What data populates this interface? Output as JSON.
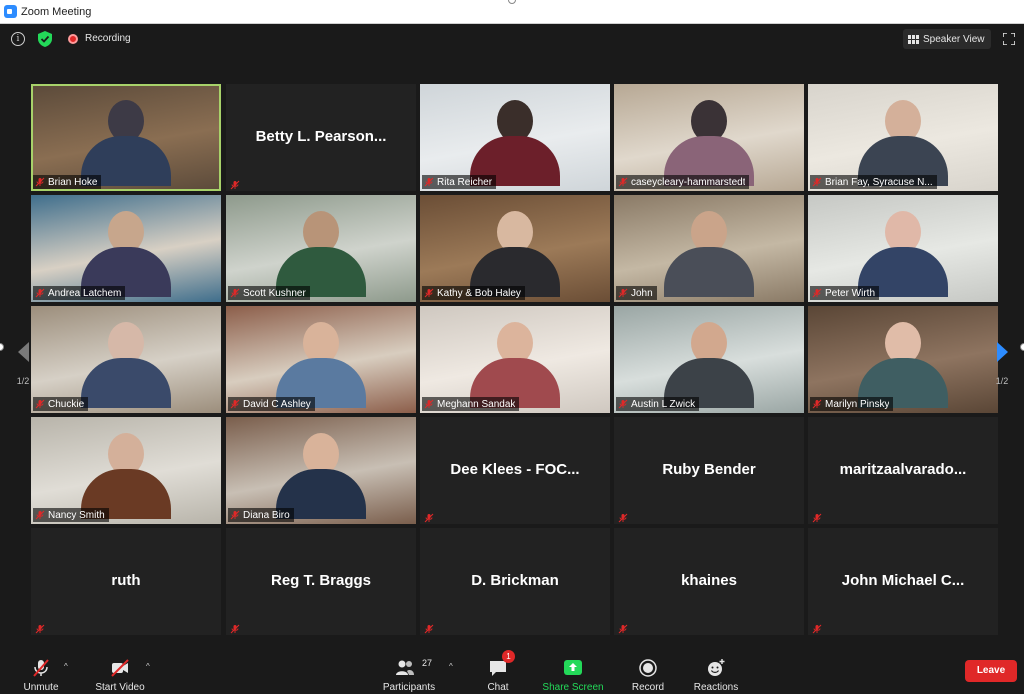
{
  "window": {
    "title": "Zoom Meeting"
  },
  "topbar": {
    "recording_label": "Recording",
    "speaker_view_label": "Speaker View"
  },
  "pagination": {
    "left_page": "1/2",
    "right_page": "1/2"
  },
  "tiles": [
    {
      "name": "Brian Hoke",
      "video": true,
      "active": true
    },
    {
      "name": "Betty L. Pearson...",
      "video": false
    },
    {
      "name": "Rita Reicher",
      "video": true
    },
    {
      "name": "caseycleary-hammarstedt",
      "video": true
    },
    {
      "name": "Brian Fay, Syracuse N...",
      "video": true
    },
    {
      "name": "Andrea Latchem",
      "video": true
    },
    {
      "name": "Scott Kushner",
      "video": true
    },
    {
      "name": "Kathy & Bob Haley",
      "video": true
    },
    {
      "name": "John",
      "video": true
    },
    {
      "name": "Peter Wirth",
      "video": true
    },
    {
      "name": "Chuckie",
      "video": true
    },
    {
      "name": "David C Ashley",
      "video": true
    },
    {
      "name": "Meghann Sandak",
      "video": true
    },
    {
      "name": "Austin L Zwick",
      "video": true
    },
    {
      "name": "Marilyn Pinsky",
      "video": true
    },
    {
      "name": "Nancy Smith",
      "video": true
    },
    {
      "name": "Diana Biro",
      "video": true
    },
    {
      "name": "Dee Klees - FOC...",
      "video": false
    },
    {
      "name": "Ruby Bender",
      "video": false
    },
    {
      "name": "maritzaalvarado...",
      "video": false
    },
    {
      "name": "ruth",
      "video": false
    },
    {
      "name": "Reg T. Braggs",
      "video": false
    },
    {
      "name": "D. Brickman",
      "video": false
    },
    {
      "name": "khaines",
      "video": false
    },
    {
      "name": "John Michael C...",
      "video": false
    }
  ],
  "toolbar": {
    "unmute": "Unmute",
    "start_video": "Start Video",
    "participants": "Participants",
    "participants_count": "27",
    "chat": "Chat",
    "chat_badge": "1",
    "share_screen": "Share Screen",
    "record": "Record",
    "reactions": "Reactions",
    "leave": "Leave"
  },
  "colors": {
    "accent_green": "#23d959",
    "leave_red": "#e02828",
    "active_speaker": "#a8d26a",
    "arrow_blue": "#2d8cff"
  }
}
